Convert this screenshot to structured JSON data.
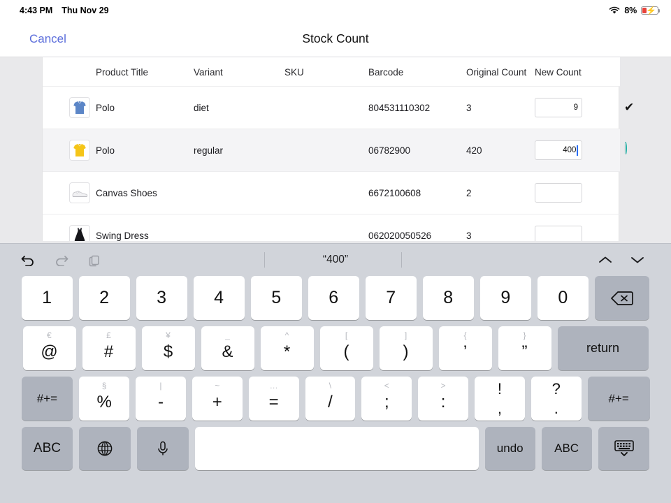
{
  "statusbar": {
    "time": "4:43 PM",
    "date": "Thu Nov 29",
    "wifi_icon": "wifi-icon",
    "battery_percent": "8%",
    "battery_icon": "battery-charging-icon"
  },
  "navbar": {
    "cancel_label": "Cancel",
    "title": "Stock Count"
  },
  "table": {
    "headers": {
      "thumbnail": "",
      "product_title": "Product Title",
      "variant": "Variant",
      "sku": "SKU",
      "barcode": "Barcode",
      "original_count": "Original Count",
      "new_count": "New Count"
    },
    "rows": [
      {
        "thumbnail": "blue-polo-shirt-thumbnail",
        "product_title": "Polo",
        "variant": "diet",
        "sku": "",
        "barcode": "804531110302",
        "original_count": "3",
        "new_count": "9",
        "status": "check",
        "active": false
      },
      {
        "thumbnail": "yellow-polo-shirt-thumbnail",
        "product_title": "Polo",
        "variant": "regular",
        "sku": "",
        "barcode": "06782900",
        "original_count": "420",
        "new_count": "400",
        "status": "spinner",
        "active": true
      },
      {
        "thumbnail": "canvas-shoe-thumbnail",
        "product_title": "Canvas Shoes",
        "variant": "",
        "sku": "",
        "barcode": "6672100608",
        "original_count": "2",
        "new_count": "",
        "status": "none",
        "active": false
      },
      {
        "thumbnail": "black-swing-dress-thumbnail",
        "product_title": "Swing Dress",
        "variant": "",
        "sku": "",
        "barcode": "062020050526",
        "original_count": "3",
        "new_count": "",
        "status": "none",
        "active": false
      }
    ]
  },
  "keyboard": {
    "toolbar": {
      "undo_icon": "undo-arrow-icon",
      "redo_icon": "redo-arrow-icon",
      "paste_icon": "clipboard-paste-icon",
      "suggestion": "“400”",
      "prev_icon": "chevron-up-icon",
      "next_icon": "chevron-down-icon"
    },
    "row1": [
      {
        "main": "1"
      },
      {
        "main": "2"
      },
      {
        "main": "3"
      },
      {
        "main": "4"
      },
      {
        "main": "5"
      },
      {
        "main": "6"
      },
      {
        "main": "7"
      },
      {
        "main": "8"
      },
      {
        "main": "9"
      },
      {
        "main": "0"
      }
    ],
    "row1_backspace": "backspace-icon",
    "row2": [
      {
        "sup": "€",
        "main": "@"
      },
      {
        "sup": "£",
        "main": "#"
      },
      {
        "sup": "¥",
        "main": "$"
      },
      {
        "sup": "_",
        "main": "&"
      },
      {
        "sup": "^",
        "main": "*"
      },
      {
        "sup": "[",
        "main": "("
      },
      {
        "sup": "]",
        "main": ")"
      },
      {
        "sup": "{",
        "main": "’"
      },
      {
        "sup": "}",
        "main": "”"
      }
    ],
    "return_label": "return",
    "row3_left_label": "#+=",
    "row3": [
      {
        "sup": "§",
        "main": "%"
      },
      {
        "sup": "|",
        "main": "-"
      },
      {
        "sup": "~",
        "main": "+"
      },
      {
        "sup": "…",
        "main": "="
      },
      {
        "sup": "\\",
        "main": "/"
      },
      {
        "sup": "<",
        "main": ";"
      },
      {
        "sup": ">",
        "main": ":"
      }
    ],
    "row3_stacked": [
      {
        "main": "!",
        "sub": ","
      },
      {
        "main": "?",
        "sub": "."
      }
    ],
    "row3_right_label": "#+=",
    "row4": {
      "abc_left_label": "ABC",
      "globe_icon": "globe-icon",
      "mic_icon": "microphone-icon",
      "space_label": "",
      "undo_label": "undo",
      "abc_right_label": "ABC",
      "dismiss_icon": "dismiss-keyboard-icon"
    }
  },
  "colors": {
    "accent_blue": "#5b6ddb",
    "spinner_teal": "#22b1a6",
    "caret_blue": "#2a6df5",
    "battery_red": "#e8423b",
    "keyboard_bg": "#d1d4da"
  }
}
